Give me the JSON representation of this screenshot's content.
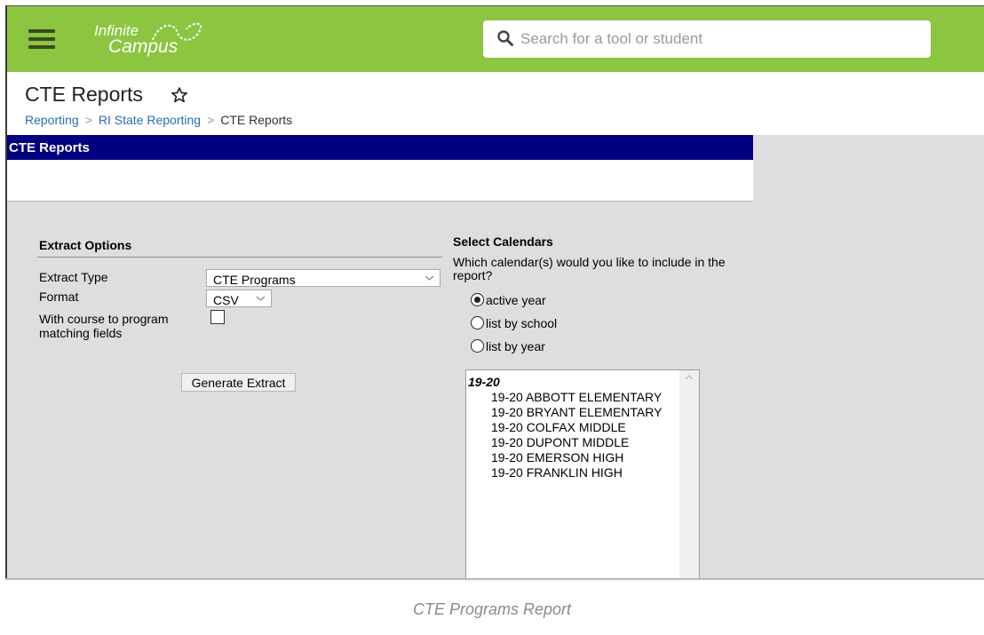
{
  "header": {
    "logo_line1": "Infinite",
    "logo_line2": "Campus",
    "search_placeholder": "Search for a tool or student"
  },
  "page": {
    "title": "CTE Reports",
    "breadcrumb": [
      "Reporting",
      "RI State Reporting",
      "CTE Reports"
    ]
  },
  "report": {
    "panel_title": "CTE Reports",
    "extract": {
      "section_title": "Extract Options",
      "extract_type_label": "Extract Type",
      "extract_type_value": "CTE Programs",
      "format_label": "Format",
      "format_value": "CSV",
      "course_matching_label": "With course to program matching fields",
      "course_matching_checked": false,
      "generate_button": "Generate Extract"
    },
    "calendars": {
      "section_title": "Select Calendars",
      "question": "Which calendar(s) would you like to include in the report?",
      "radio_options": [
        "active year",
        "list by school",
        "list by year"
      ],
      "selected_option": "active year",
      "group_label": "19-20",
      "items": [
        "19-20 ABBOTT ELEMENTARY",
        "19-20 BRYANT ELEMENTARY",
        "19-20 COLFAX MIDDLE",
        "19-20 DUPONT MIDDLE",
        "19-20 EMERSON HIGH",
        "19-20 FRANKLIN HIGH"
      ]
    }
  },
  "caption": "CTE Programs Report",
  "colors": {
    "topbar": "#8cc540",
    "report_header": "#000080",
    "link": "#2a6db5"
  }
}
